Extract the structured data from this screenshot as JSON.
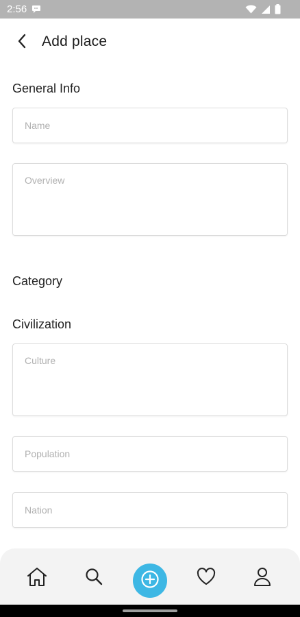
{
  "status_bar": {
    "time": "2:56",
    "icons": [
      "message-notification-icon",
      "wifi-icon",
      "signal-icon",
      "battery-icon"
    ]
  },
  "app_bar": {
    "title": "Add place",
    "back_icon": "back-arrow-icon"
  },
  "sections": {
    "general_info": "General Info",
    "category": "Category",
    "civilization": "Civilization"
  },
  "fields": {
    "name": {
      "placeholder": "Name",
      "value": ""
    },
    "overview": {
      "placeholder": "Overview",
      "value": ""
    },
    "culture": {
      "placeholder": "Culture",
      "value": ""
    },
    "population": {
      "placeholder": "Population",
      "value": ""
    },
    "nation": {
      "placeholder": "Nation",
      "value": ""
    }
  },
  "bottom_nav": {
    "items": [
      "home-icon",
      "search-icon",
      "add-place-icon",
      "favorites-icon",
      "profile-icon"
    ],
    "accent_color": "#3db7e4"
  }
}
